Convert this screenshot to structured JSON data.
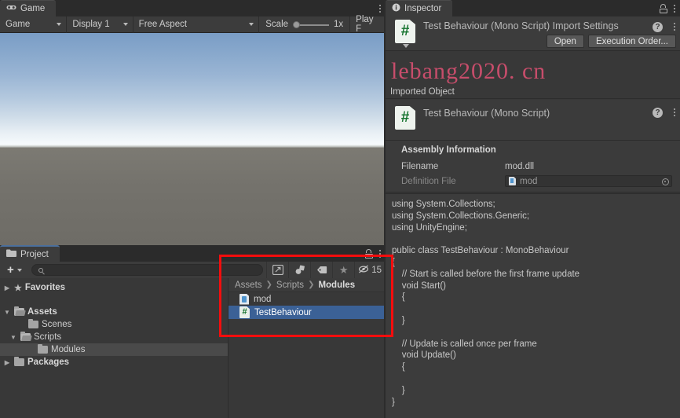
{
  "game": {
    "tab_label": "Game",
    "tab_icon": "game-controller-icon",
    "toolbar": {
      "view_mode": "Game",
      "display": "Display 1",
      "aspect": "Free Aspect",
      "scale_label": "Scale",
      "scale_value": "1x",
      "play_mode": "Play F"
    }
  },
  "project": {
    "tab_label": "Project",
    "tab_icon": "folder-icon",
    "toolbar": {
      "create_label": "+",
      "search_value": "",
      "search_placeholder": "",
      "hidden_count": "15"
    },
    "tree": [
      {
        "label": "Favorites",
        "icon": "star-icon",
        "arrow": "collapsed",
        "indent": 0,
        "bold": true,
        "selected": false
      },
      {
        "label": "",
        "icon": "spacer",
        "arrow": "none",
        "indent": 0,
        "bold": false,
        "selected": false
      },
      {
        "label": "Assets",
        "icon": "folder-open-icon",
        "arrow": "expanded",
        "indent": 0,
        "bold": true,
        "selected": false
      },
      {
        "label": "Scenes",
        "icon": "folder-icon",
        "arrow": "none",
        "indent": 1,
        "bold": false,
        "selected": false
      },
      {
        "label": "Scripts",
        "icon": "folder-open-icon",
        "arrow": "expanded",
        "indent": 1,
        "bold": false,
        "selected": false
      },
      {
        "label": "Modules",
        "icon": "folder-icon",
        "arrow": "none",
        "indent": 2,
        "bold": false,
        "selected": true
      },
      {
        "label": "Packages",
        "icon": "folder-icon",
        "arrow": "collapsed",
        "indent": 0,
        "bold": true,
        "selected": false
      }
    ],
    "breadcrumb": [
      "Assets",
      "Scripts",
      "Modules"
    ],
    "files": [
      {
        "label": "mod",
        "icon": "assembly-definition-icon",
        "selected": false
      },
      {
        "label": "TestBehaviour",
        "icon": "csharp-script-icon",
        "selected": true
      }
    ]
  },
  "inspector": {
    "tab_label": "Inspector",
    "tab_icon": "info-icon",
    "title": "Test Behaviour (Mono Script) Import Settings",
    "buttons": {
      "open": "Open",
      "execution_order": "Execution Order..."
    },
    "imported_object_label": "Imported Object",
    "imported_object_name": "Test Behaviour (Mono Script)",
    "assembly": {
      "section_title": "Assembly Information",
      "filename_label": "Filename",
      "filename_value": "mod.dll",
      "definition_label": "Definition File",
      "definition_value": "mod"
    },
    "code": "using System.Collections;\nusing System.Collections.Generic;\nusing UnityEngine;\n\npublic class TestBehaviour : MonoBehaviour\n{\n    // Start is called before the first frame update\n    void Start()\n    {\n\n    }\n\n    // Update is called once per frame\n    void Update()\n    {\n\n    }\n}"
  },
  "watermark": "lebang2020. cn",
  "colors": {
    "selection_blue": "#3b6196",
    "annotation_red": "#f40d0d",
    "panel_bg": "#383838",
    "toolbar_bg": "#3c3c3c",
    "watermark_pink": "#cf4f6e"
  }
}
